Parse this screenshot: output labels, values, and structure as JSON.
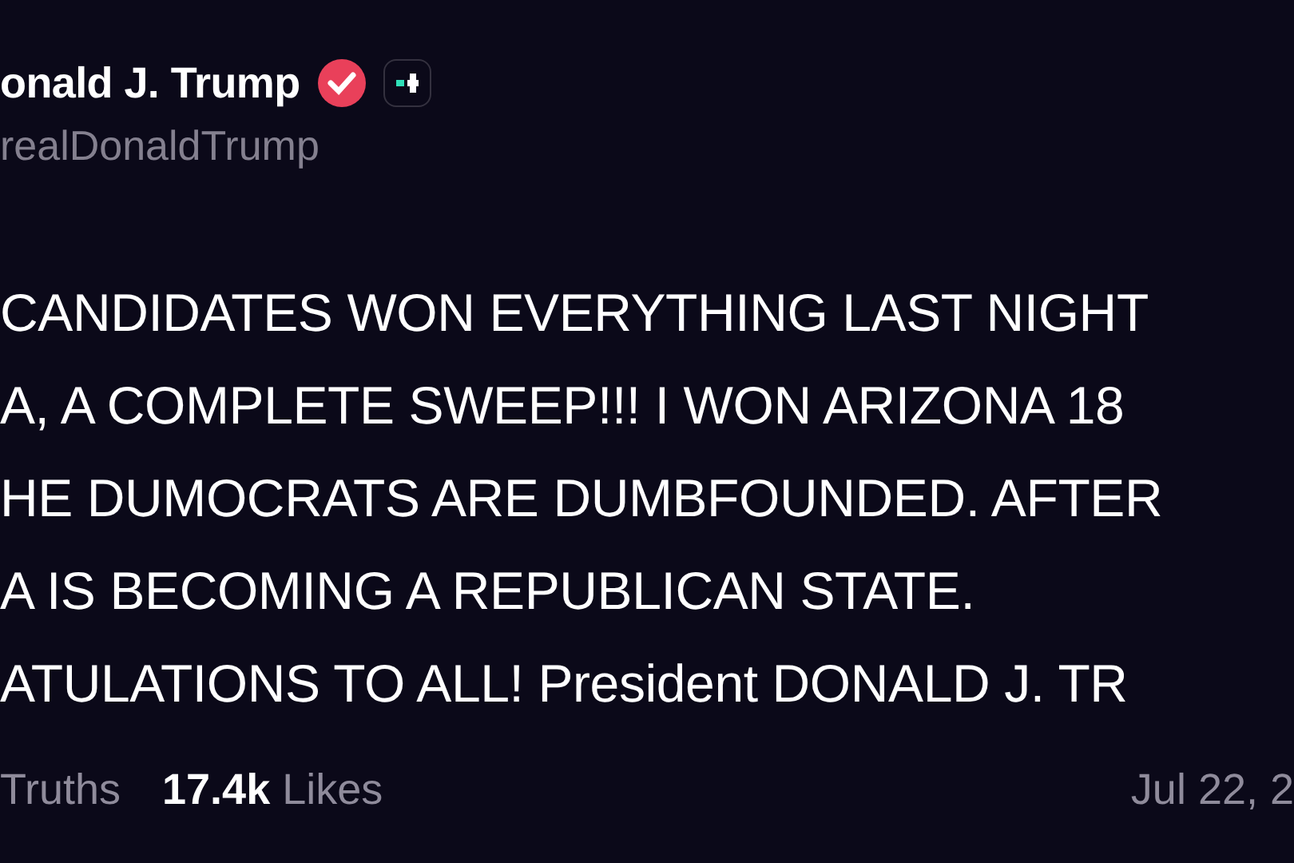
{
  "author": {
    "name": "onald J. Trump",
    "verified": true,
    "handle": "realDonaldTrump"
  },
  "body_lines": [
    "CANDIDATES WON EVERYTHING LAST NIGHT",
    "A, A COMPLETE SWEEP!!! I WON ARIZONA 18",
    "HE DUMOCRATS ARE DUMBFOUNDED. AFTER",
    "A IS BECOMING A REPUBLICAN STATE.",
    "ATULATIONS TO ALL! President DONALD J. TR"
  ],
  "stats": [
    "Truths",
    "**17.4k** Likes"
  ],
  "date": "Jul 22, 2"
}
